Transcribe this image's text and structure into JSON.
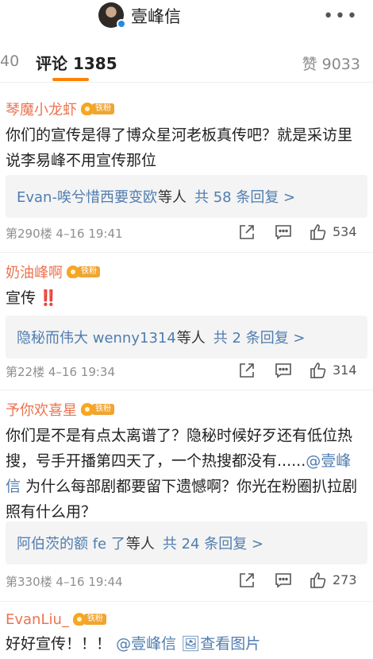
{
  "header": {
    "title": "壹峰信",
    "more": "•••"
  },
  "tabs": {
    "reposts": "40",
    "comments": "评论 1385",
    "likes": "赞 9033"
  },
  "comments": [
    {
      "user": "琴魔小龙虾",
      "fan_badge": "铁粉",
      "text": "你们的宣传是得了博众星河老板真传吧？就是采访里说李易峰不用宣传那位",
      "reply_users": "Evan-唉兮惜西要变欧",
      "reply_tail": "等人",
      "reply_count": "共 58 条回复 >",
      "floor": "第290楼",
      "time": "4–16 19:41",
      "likes": "534"
    },
    {
      "user": "奶油峰啊",
      "fan_badge": "铁粉",
      "text": "宣传",
      "emoji": "‼️",
      "reply_users": "隐秘而伟大 wenny1314",
      "reply_tail": "等人",
      "reply_count": "共 2 条回复 >",
      "floor": "第22楼",
      "time": "4–16 19:34",
      "likes": "314"
    },
    {
      "user": "予你欢喜星",
      "fan_badge": "铁粉",
      "text_a": "你们是不是有点太离谱了？隐秘时候好歹还有低位热搜，号手开播第四天了，一个热搜都没有......",
      "mention": "@壹峰信",
      "text_b": "为什么每部剧都要留下遗憾啊？你光在粉圈扒拉剧照有什么用？",
      "reply_users": "阿伯茨的额 fe 了",
      "reply_tail": "等人",
      "reply_count": "共 24 条回复 >",
      "floor": "第330楼",
      "time": "4–16 19:44",
      "likes": "273"
    },
    {
      "user": "EvanLiu_",
      "fan_badge": "铁粉",
      "text": "好好宣传！！！",
      "mention": "@壹峰信",
      "pic_link": "查看图片"
    }
  ]
}
